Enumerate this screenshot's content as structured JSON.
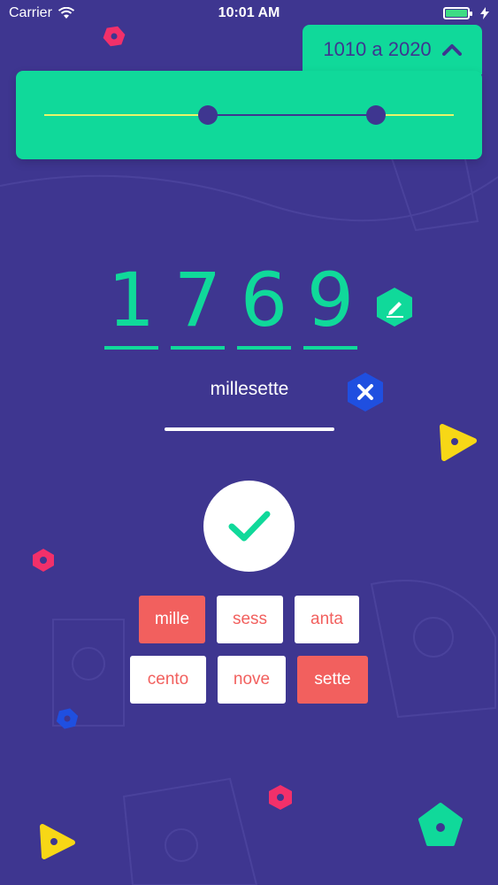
{
  "status_bar": {
    "carrier": "Carrier",
    "time": "10:01 AM"
  },
  "range": {
    "label": "1010 a 2020",
    "low_fraction": 0.4,
    "high_fraction": 0.81
  },
  "number": {
    "digits": [
      "1",
      "7",
      "6",
      "9"
    ]
  },
  "answer": {
    "text": "millesette"
  },
  "tiles": [
    {
      "label": "mille",
      "selected": true
    },
    {
      "label": "sess",
      "selected": false
    },
    {
      "label": "anta",
      "selected": false
    },
    {
      "label": "cento",
      "selected": false
    },
    {
      "label": "nove",
      "selected": false
    },
    {
      "label": "sette",
      "selected": true
    }
  ],
  "colors": {
    "background": "#3e3690",
    "accent_green": "#10d99a",
    "tile_red": "#f2605e",
    "clear_blue": "#1f4fe0",
    "track_yellow": "#e8f46a"
  },
  "icons": {
    "collapse": "chevron-up-icon",
    "edit": "pencil-icon",
    "clear": "close-icon",
    "submit": "check-icon"
  }
}
